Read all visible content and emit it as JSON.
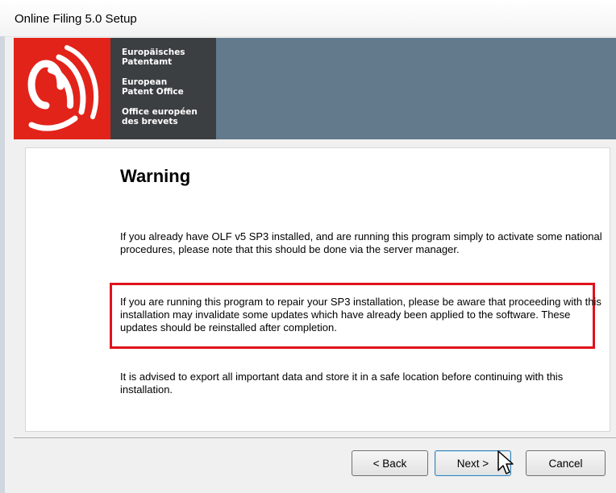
{
  "window": {
    "title": "Online Filing 5.0 Setup"
  },
  "header": {
    "logo_lines": [
      "Europäisches",
      "Patentamt",
      "European",
      "Patent Office",
      "Office européen",
      "des brevets"
    ],
    "colors": {
      "logo_red": "#e2231a",
      "logo_dark": "#3c3f42",
      "banner": "#637a8c"
    }
  },
  "content": {
    "heading": "Warning",
    "para1": "If you already have OLF v5 SP3 installed, and are running this program simply to activate some national procedures, please note that this should be done via the server manager.",
    "para2": "If you are running this program to repair your SP3 installation, please be aware that proceeding with this installation may invalidate some updates which have already been applied to the software. These updates should be reinstalled after completion.",
    "para3": "It is advised to export all important data and store it in a safe location before continuing with this installation.",
    "highlight_color": "#e0121b"
  },
  "buttons": {
    "back": "< Back",
    "next": "Next >",
    "cancel": "Cancel"
  },
  "icons": {
    "cursor": "arrow-cursor-icon"
  }
}
